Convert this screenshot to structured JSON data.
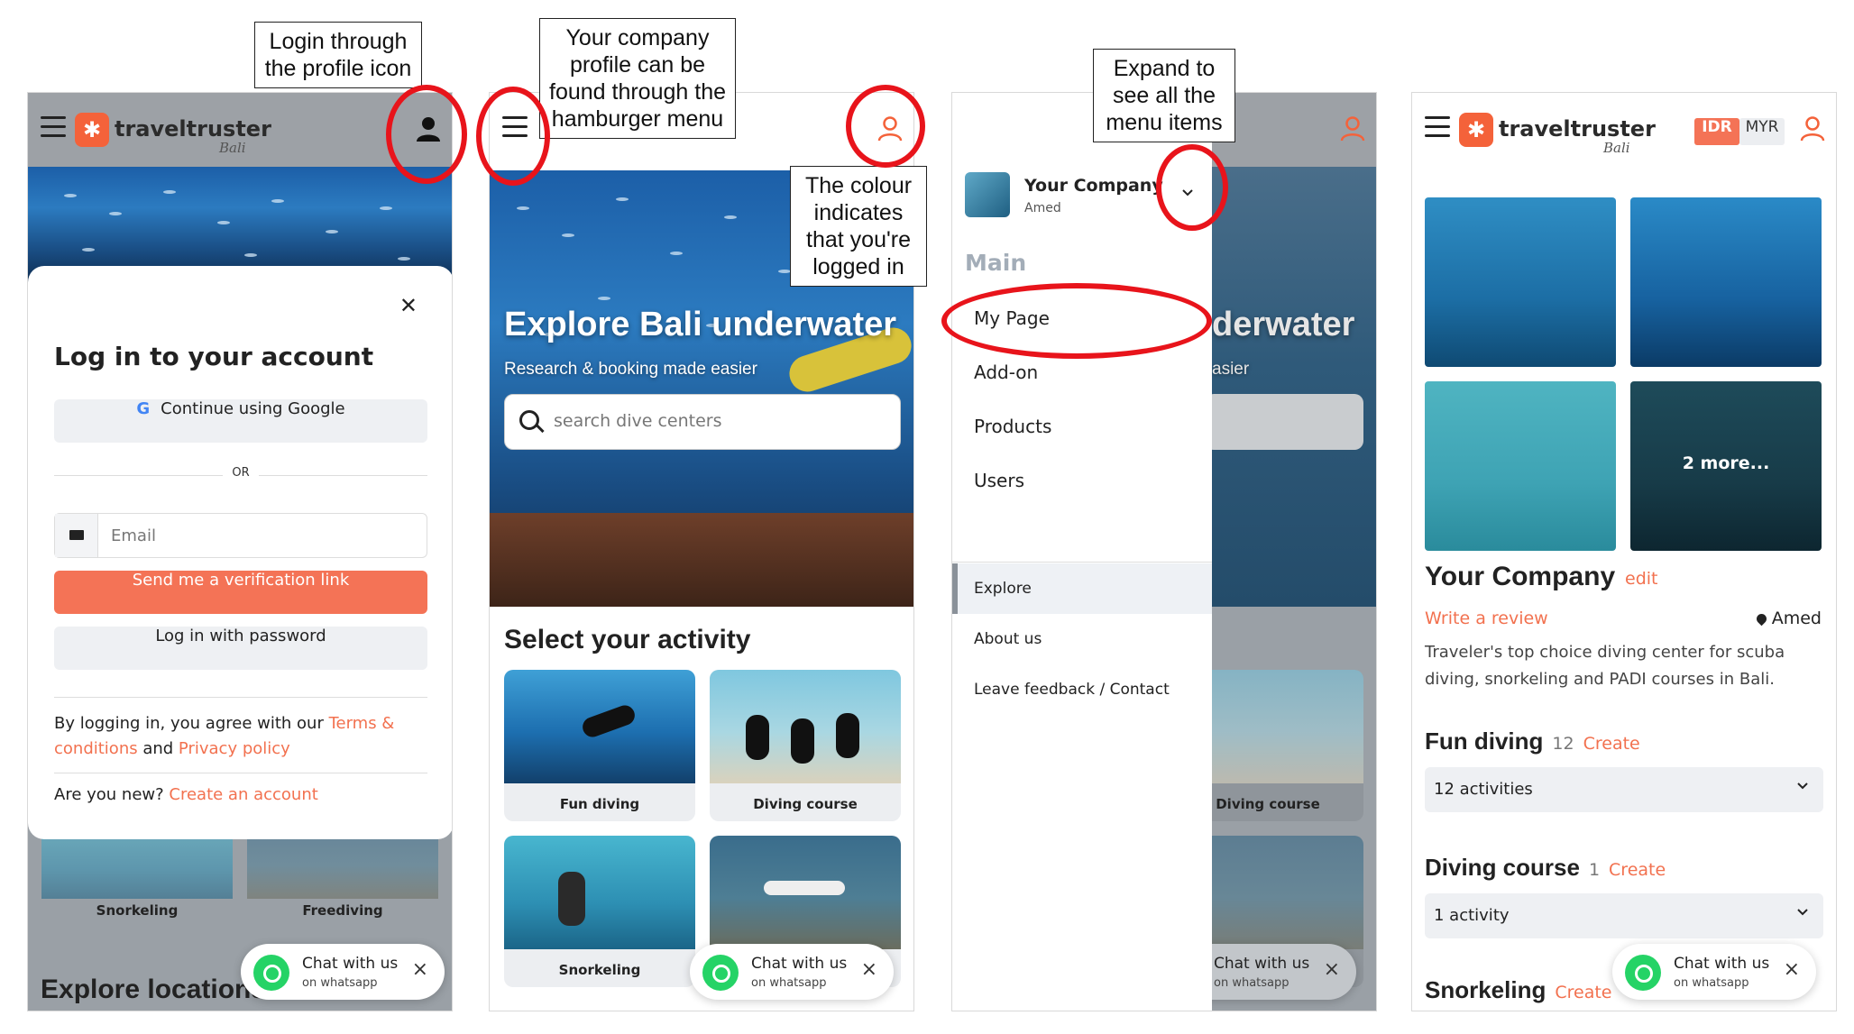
{
  "brand": {
    "name": "traveltruster",
    "region": "Bali",
    "accent": "#f4623a"
  },
  "panel1": {
    "modal_title": "Log in to your account",
    "google_label": "Continue using Google",
    "or_label": "OR",
    "email_placeholder": "Email",
    "verify_label": "Send me a verification link",
    "password_label": "Log in with password",
    "agree_prefix": "By logging in, you agree with our ",
    "terms_label": "Terms & conditions",
    "agree_and": " and ",
    "privacy_label": "Privacy policy",
    "new_prefix": "Are you new? ",
    "create_account": "Create an account",
    "card_snorkeling": "Snorkeling",
    "card_freediving": "Freediving",
    "explore_locations": "Explore locations"
  },
  "panel2": {
    "hero_title": "Explore Bali underwater",
    "hero_sub": "Research & booking made easier",
    "search_placeholder": "search dive centers",
    "section_title": "Select your activity",
    "activities": [
      "Fun diving",
      "Diving course",
      "Snorkeling",
      ""
    ]
  },
  "panel3": {
    "company_name": "Your Company",
    "company_location": "Amed",
    "main_label": "Main",
    "main_items": [
      "My Page",
      "Add-on",
      "Products",
      "Users"
    ],
    "secondary_items": [
      "Explore",
      "About us",
      "Leave feedback / Contact"
    ],
    "bg_title_fragment": "derwater",
    "bg_sub_fragment": "asier",
    "card_diving_course": "Diving course"
  },
  "panel4": {
    "currency_active": "IDR",
    "currency_other": "MYR",
    "more_photos": "2 more...",
    "company_name": "Your Company",
    "edit_label": "edit",
    "review_label": "Write a review",
    "location": "Amed",
    "description": "Traveler's top choice diving center for scuba diving, snorkeling and PADI courses in Bali.",
    "fun_diving": {
      "title": "Fun diving",
      "count": "12",
      "create": "Create",
      "select": "12 activities"
    },
    "diving_course": {
      "title": "Diving course",
      "count": "1",
      "create": "Create",
      "select": "1 activity"
    },
    "snorkeling": {
      "title": "Snorkeling",
      "create": "Create"
    }
  },
  "chat": {
    "title": "Chat with us",
    "subtitle": "on whatsapp",
    "close": "×"
  },
  "callouts": {
    "login": "Login through the profile icon",
    "hamburger": "Your company profile can be found through the hamburger menu",
    "colour": "The colour indicates that you're logged in",
    "expand": "Expand to see all the menu items"
  },
  "icons": {
    "menu": "hamburger-icon",
    "profile": "user-icon",
    "close": "close-icon",
    "search": "search-icon",
    "chevron": "chevron-down-icon",
    "whatsapp": "whatsapp-icon",
    "mail": "mail-icon",
    "pin": "map-pin-icon"
  },
  "colors": {
    "highlight": "#e8141b",
    "link": "#f2714f",
    "logged_in_icon": "#f4623a"
  }
}
